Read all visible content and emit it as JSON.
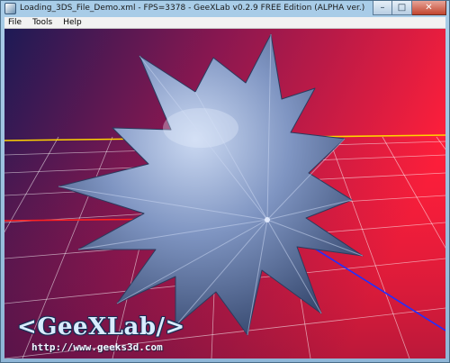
{
  "window": {
    "title": "Loading_3DS_File_Demo.xml - FPS=3378 - GeeXLab v0.2.9 FREE Edition (ALPHA ver.)",
    "controls": {
      "minimize": "–",
      "maximize": "□",
      "close": "✕"
    }
  },
  "menu": {
    "items": [
      {
        "label": "File"
      },
      {
        "label": "Tools"
      },
      {
        "label": "Help"
      }
    ]
  },
  "overlay": {
    "logo": "<GeeXLab/>",
    "url": "http://www.geeks3d.com"
  },
  "colors": {
    "bg_dark": "#1d1a55",
    "bg_red": "#ff1f3a",
    "shape": "#6f86b5",
    "axis_x": "#ff2020",
    "axis_y": "#ffd400",
    "axis_z": "#2030ff"
  },
  "icons": {
    "app": "window-icon",
    "minimize": "minimize-icon",
    "maximize": "maximize-icon",
    "close": "close-icon"
  }
}
